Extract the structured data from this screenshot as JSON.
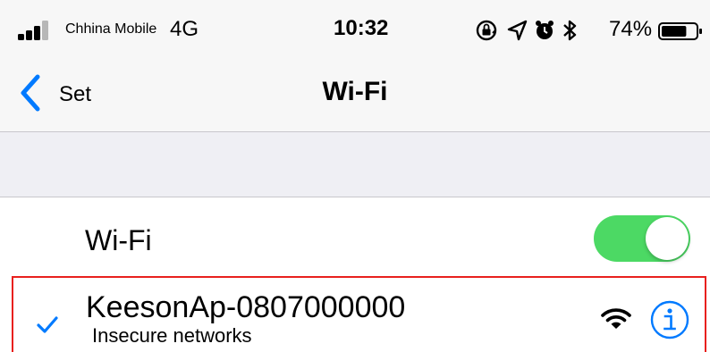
{
  "status_bar": {
    "carrier": "Chhina Mobile",
    "network_type": "4G",
    "time": "10:32",
    "battery_percent": "74%",
    "battery_level": 0.74,
    "icons": [
      "orientation-lock-icon",
      "location-icon",
      "alarm-icon",
      "bluetooth-icon"
    ]
  },
  "nav": {
    "back_label": "Set",
    "title": "Wi-Fi"
  },
  "wifi_toggle": {
    "label": "Wi-Fi",
    "on": true
  },
  "connected_network": {
    "ssid": "KeesonAp-0807000000",
    "subtitle": "Insecure networks",
    "selected": true
  },
  "colors": {
    "ios_blue": "#007aff",
    "toggle_on": "#4cd964",
    "highlight_border": "#e8201e",
    "nav_background": "#f7f7f7",
    "group_background": "#efeff4"
  }
}
